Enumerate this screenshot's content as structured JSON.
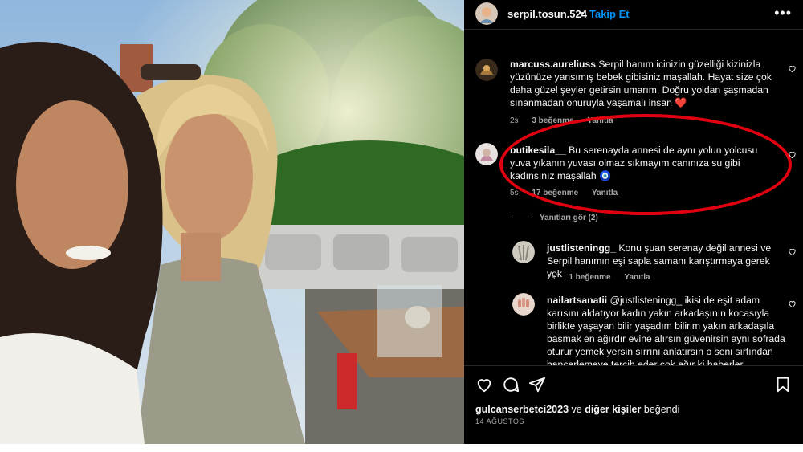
{
  "post": {
    "username": "serpil.tosun.524",
    "separator": "•",
    "follow_label": "Takip Et",
    "more_label": "•••"
  },
  "comments": [
    {
      "username": "marcuss.aureliuss",
      "text": " Serpil hanım icinizin güzelliği kizinizla yüzünüze yansımış bebek gibisiniz maşallah. Hayat size çok daha güzel şeyler getirsin umarım. Doğru yoldan şaşmadan sınanmadan onuruyla yaşamalı insan ❤️",
      "time": "2s",
      "likes": "3 beğenme",
      "reply": "Yanıtla"
    },
    {
      "username": "butikesila__",
      "text": " Bu serenayda annesi de aynı yolun yolcusu yuva yıkanın yuvası olmaz.sıkmayım canınıza su gibi kadınsınız maşallah 🧿",
      "time": "5s",
      "likes": "17 beğenme",
      "reply": "Yanıtla"
    }
  ],
  "view_replies": "Yanıtları gör (2)",
  "replies": [
    {
      "username": "justlisteningg_",
      "text": " Konu şuan serenay değil annesi ve Serpil hanımın eşi sapla samanı karıştırmaya gerek yok",
      "time": "2s",
      "likes": "1 beğenme",
      "reply": "Yanıtla"
    },
    {
      "username": "nailartsanatii",
      "text": " @justlisteningg_ ikisi de eşit adam karısını aldatıyor kadın yakın arkadaşının kocasıyla birlikte yaşayan bilir yaşadım bilirim yakın arkadaşıla basmak en ağırdır evine alırsın güvenirsin aynı sofrada oturur yemek yersin sırrını anlatırsın o seni sırtından hançerlemeye tercih eder çok ağır ki haberler"
    }
  ],
  "likes": {
    "user": "gulcanserbetci2023",
    "and": " ve ",
    "others": "diğer kişiler",
    "suffix": " beğendi"
  },
  "date": "14 AĞUSTOS",
  "colors": {
    "accent": "#0095f6",
    "highlight": "#e10010",
    "panel_bg": "#000000"
  }
}
